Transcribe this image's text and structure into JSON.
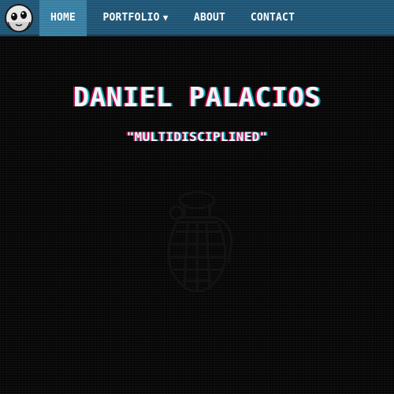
{
  "nav": {
    "items": [
      {
        "label": "HOME",
        "active": true
      },
      {
        "label": "PORTFOLIO",
        "has_dropdown": true,
        "dropdown_icon": "caret-down-icon"
      },
      {
        "label": "ABOUT"
      },
      {
        "label": "CONTACT"
      }
    ],
    "logo_icon": "ghost-avatar-icon",
    "bar_color": "#245c7d",
    "active_color": "#3d86aa"
  },
  "hero": {
    "title": "DANIEL PALACIOS",
    "subtitle": "\"MULTIDISCIPLINED\"",
    "emblem_icon": "pineapple-grenade-emblem-icon"
  },
  "colors": {
    "background": "#060606",
    "text": "#f4f4f4",
    "glitch_red": "#ff005a",
    "glitch_cyan": "#00dcff"
  }
}
